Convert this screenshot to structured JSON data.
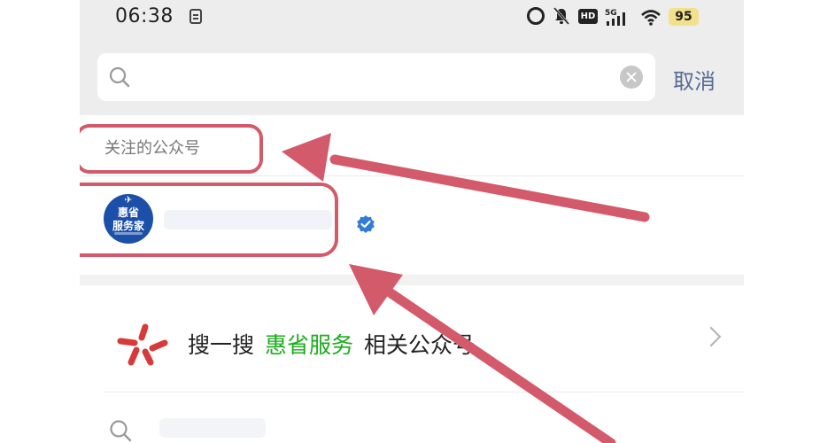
{
  "status_bar": {
    "time": "06:38",
    "hd_label": "HD",
    "network_label": "5G",
    "battery_level": "95"
  },
  "search": {
    "query": "",
    "cancel_label": "取消"
  },
  "section": {
    "label": "关注的公众号"
  },
  "account": {
    "avatar_line1": "惠省",
    "avatar_line2": "服务家",
    "verified": true
  },
  "sogou": {
    "prefix": "搜一搜",
    "keyword": "惠省服务",
    "suffix": "相关公众号"
  },
  "colors": {
    "highlight": "#d35a6a",
    "link": "#576b95",
    "keyword": "#1aad19",
    "verified": "#2f7bd6",
    "avatar_bg": "#1c4fa8"
  },
  "icons": {
    "search": "search-icon",
    "clear": "clear-icon",
    "verified": "verified-badge-icon",
    "sogou": "sogou-logo-icon",
    "chevron": "chevron-right-icon"
  }
}
